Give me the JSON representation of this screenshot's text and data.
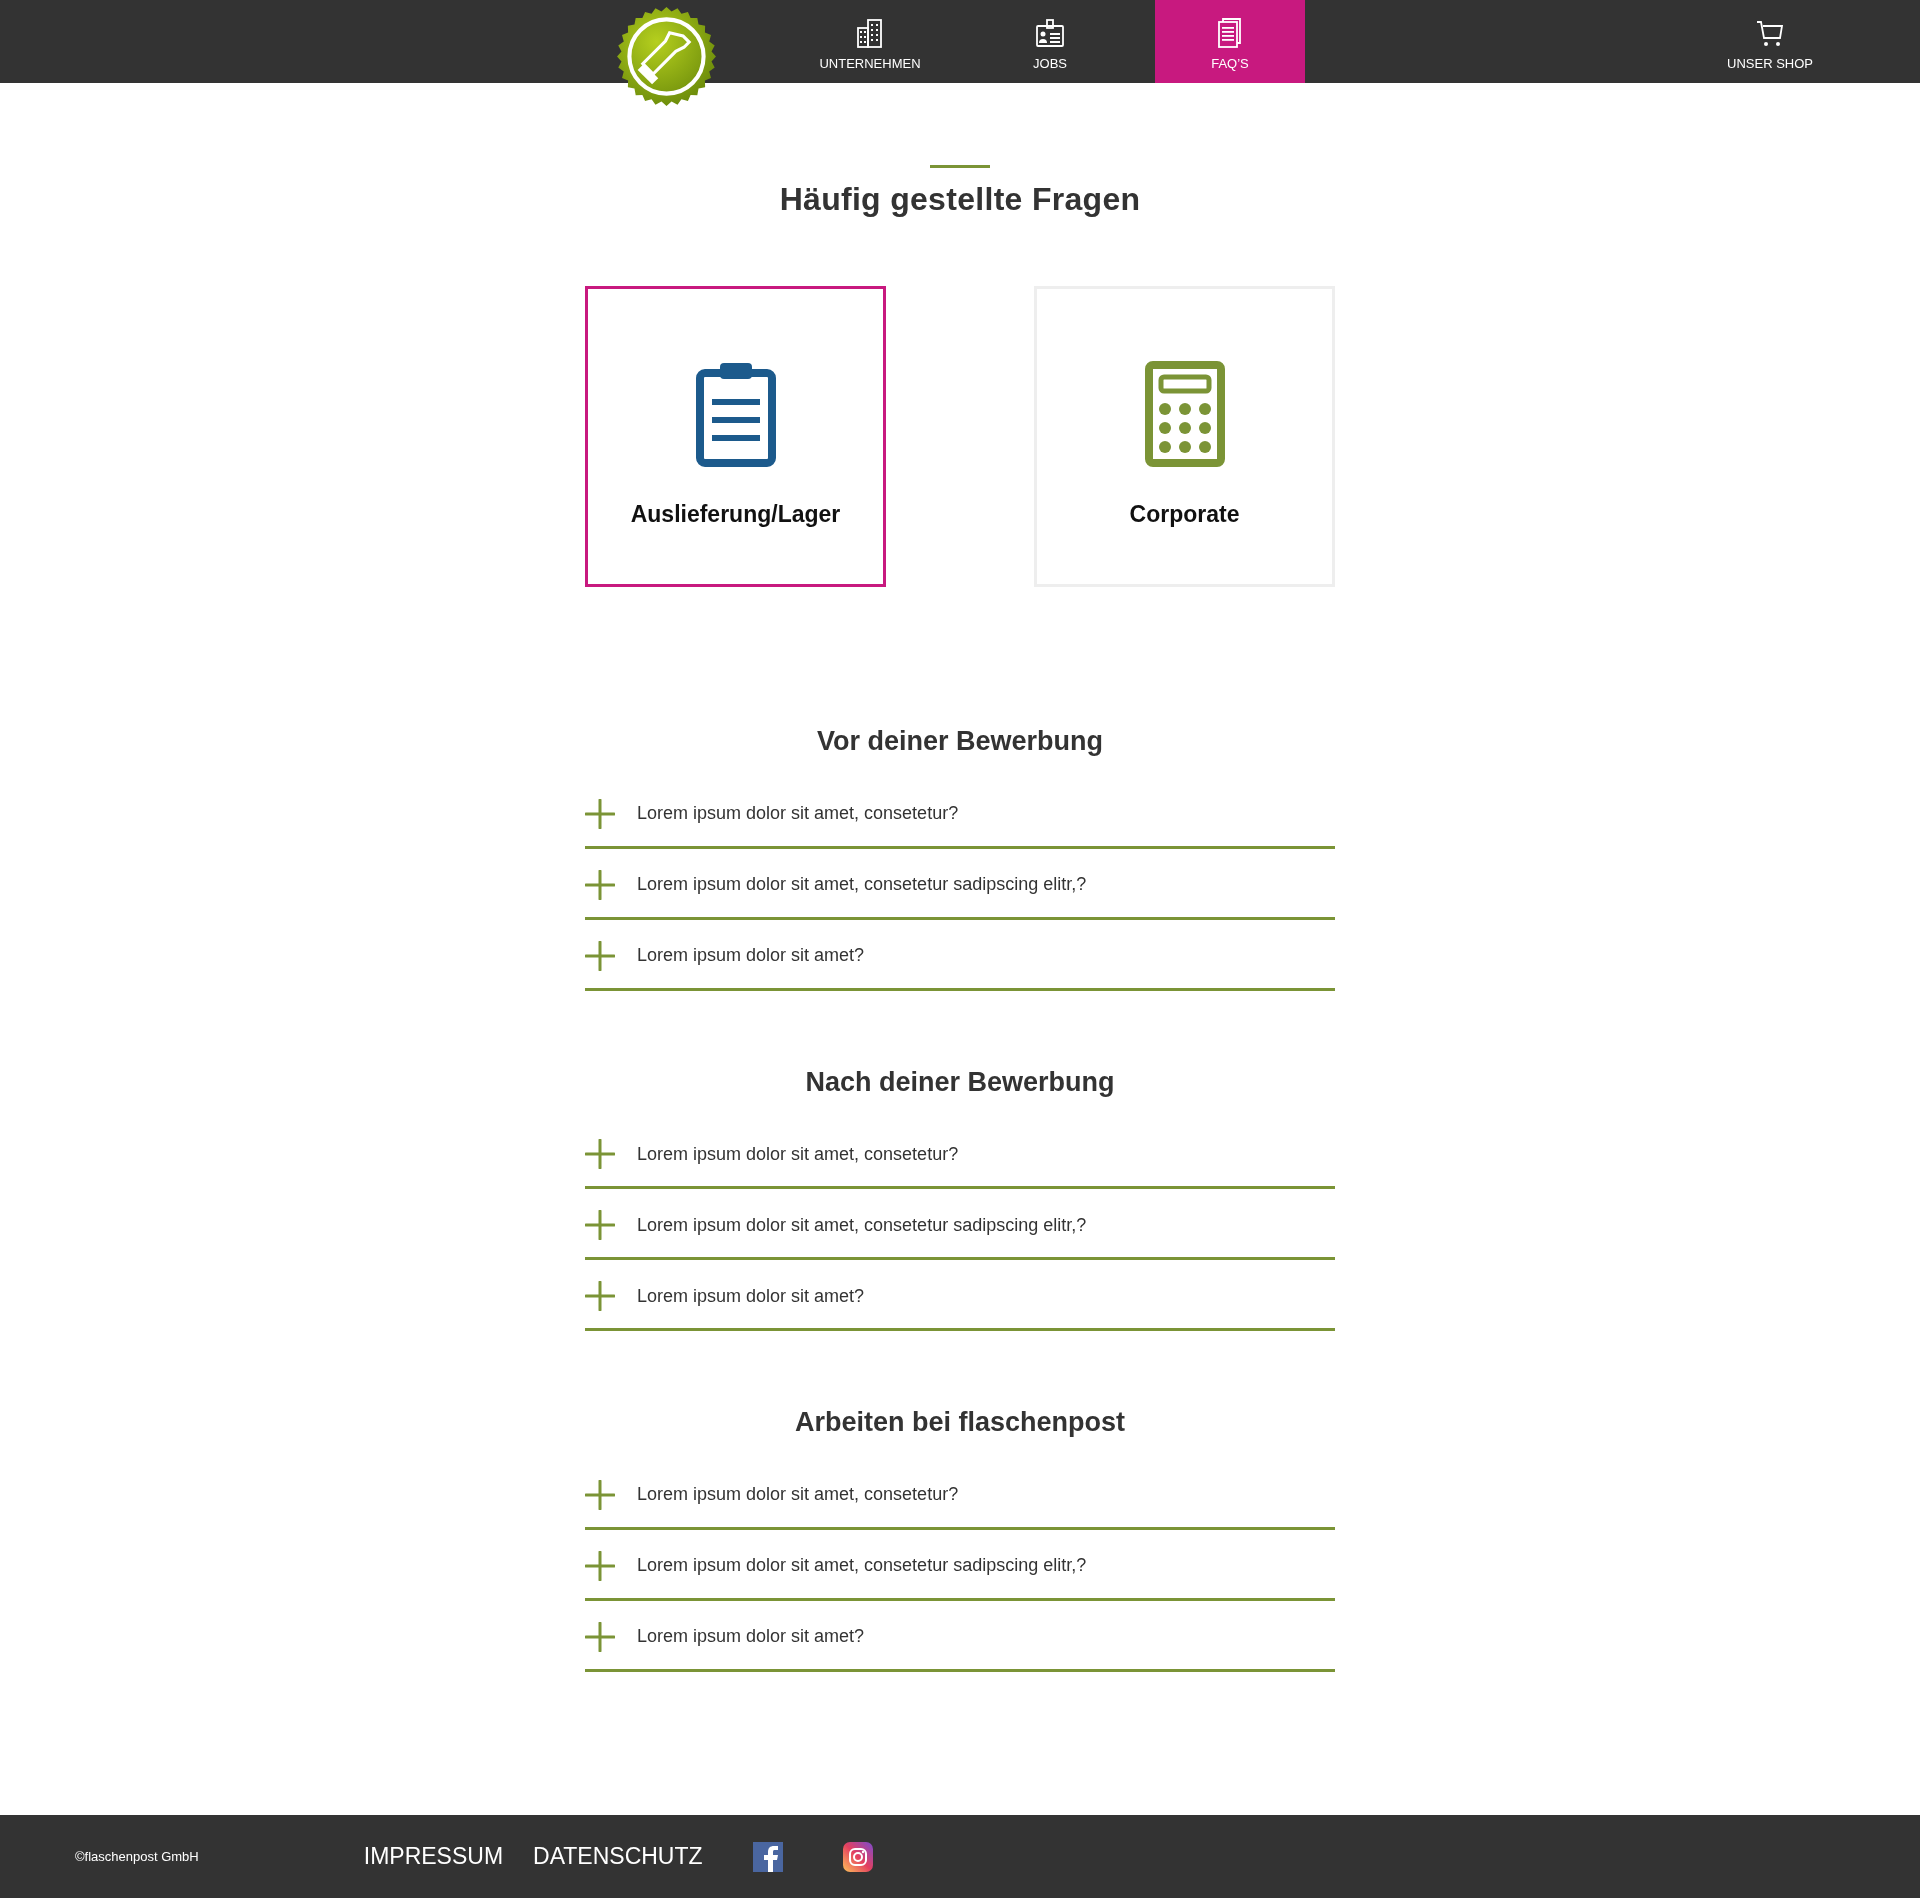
{
  "nav": {
    "items": [
      {
        "label": "UNTERNEHMEN",
        "kind": "building",
        "selected": false
      },
      {
        "label": "JOBS",
        "kind": "idcard",
        "selected": false
      },
      {
        "label": "FAQ’S",
        "kind": "document",
        "selected": true
      }
    ],
    "shop": {
      "label": "UNSER SHOP"
    }
  },
  "title": "Häufig gestellte Fragen",
  "categories": [
    {
      "label": "Auslieferung/Lager",
      "kind": "clipboard",
      "color": "#1c5a8c",
      "selected": true
    },
    {
      "label": "Corporate",
      "kind": "calculator",
      "color": "#7b9436",
      "selected": false
    }
  ],
  "sections": [
    {
      "heading": "Vor deiner Bewerbung",
      "questions": [
        {
          "text": "Lorem ipsum dolor sit amet, consetetur?",
          "expanded": false
        },
        {
          "text": "Lorem ipsum dolor sit amet, consetetur sadipscing elitr,?",
          "expanded": false
        },
        {
          "text": "Lorem ipsum dolor sit amet?",
          "expanded": false
        }
      ]
    },
    {
      "heading": "Nach deiner Bewerbung",
      "questions": [
        {
          "text": "Lorem ipsum dolor sit amet, consetetur?",
          "expanded": false
        },
        {
          "text": "Lorem ipsum dolor sit amet, consetetur sadipscing elitr,?",
          "expanded": false
        },
        {
          "text": "Lorem ipsum dolor sit amet?",
          "expanded": false
        }
      ]
    },
    {
      "heading": "Arbeiten bei flaschenpost",
      "questions": [
        {
          "text": "Lorem ipsum dolor sit amet, consetetur?",
          "expanded": false
        },
        {
          "text": "Lorem ipsum dolor sit amet, consetetur sadipscing elitr,?",
          "expanded": false
        },
        {
          "text": "Lorem ipsum dolor sit amet?",
          "expanded": false
        }
      ]
    }
  ],
  "footer": {
    "copyright": "©flaschenpost GmbH",
    "links": [
      "IMPRESSUM",
      "DATENSCHUTZ"
    ],
    "social": [
      {
        "kind": "facebook"
      },
      {
        "kind": "instagram"
      }
    ]
  }
}
